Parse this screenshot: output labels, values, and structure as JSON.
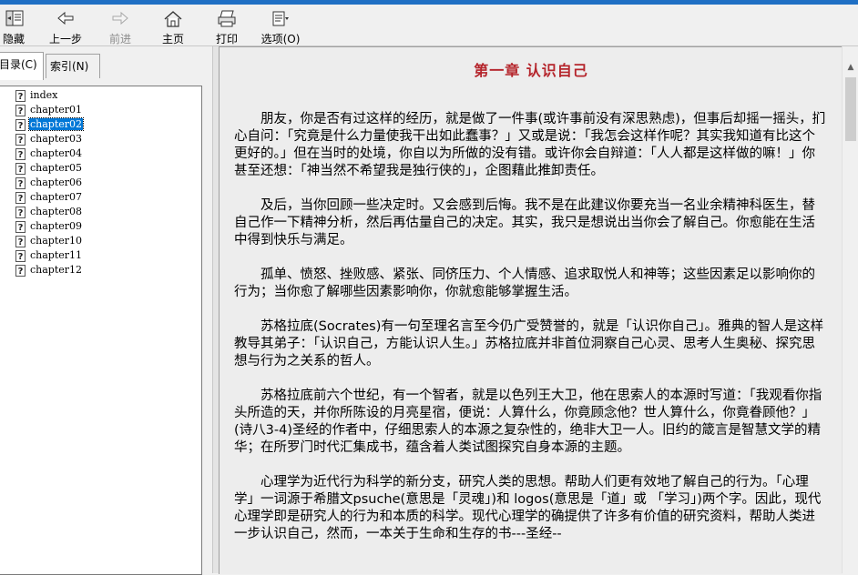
{
  "toolbar": {
    "hide": "隐藏",
    "back": "上一步",
    "forward": "前进",
    "home": "主页",
    "print": "打印",
    "options": "选项(O)"
  },
  "tabs": {
    "contents": "目录(C)",
    "index": "索引(N)"
  },
  "tree": {
    "items": [
      "index",
      "chapter01",
      "chapter02",
      "chapter03",
      "chapter04",
      "chapter05",
      "chapter06",
      "chapter07",
      "chapter08",
      "chapter09",
      "chapter10",
      "chapter11",
      "chapter12"
    ],
    "selected": "chapter02"
  },
  "content": {
    "title": "第一章  认识自己",
    "paragraphs": [
      "朋友，你是否有过这样的经历，就是做了一件事(或许事前没有深思熟虑)，但事后却摇一摇头，扪心自问：「究竟是什么力量使我干出如此蠢事？」又或是说：「我怎会这样作呢？其实我知道有比这个更好的。」但在当时的处境，你自以为所做的没有错。或许你会自辩道：「人人都是这样做的嘛！」你甚至还想：「神当然不希望我是独行侠的」，企图藉此推卸责任。",
      "及后，当你回顾一些决定时。又会感到后悔。我不是在此建议你要充当一名业余精神科医生，替自己作一下精神分析，然后再估量自己的决定。其实，我只是想说出当你会了解自己。你愈能在生活中得到快乐与满足。",
      "孤单、愤怒、挫败感、紧张、同侪压力、个人情感、追求取悦人和神等；这些因素足以影响你的行为；当你愈了解哪些因素影响你，你就愈能够掌握生活。",
      "苏格拉底(Socrates)有一句至理名言至今仍广受赞誉的，就是「认识你自己」。雅典的智人是这样教导其弟子：「认识自己，方能认识人生。」苏格拉底并非首位洞察自己心灵、思考人生奥秘、探究思想与行为之关系的哲人。",
      "苏格拉底前六个世纪，有一个智者，就是以色列王大卫，他在思索人的本源时写道：「我观看你指头所造的天，并你所陈设的月亮星宿，便说：人算什么，你竟顾念他？世人算什么，你竟眷顾他？」(诗八3-4)圣经的作者中，仔细思索人的本源之复杂性的，绝非大卫一人。旧约的箴言是智慧文学的精华；在所罗门时代汇集成书，蕴含着人类试图探究自身本源的主题。",
      "心理学为近代行为科学的新分支，研究人类的思想。帮助人们更有效地了解自己的行为。「心理学」一词源于希腊文psuche(意思是「灵魂」)和 logos(意思是「道」或 「学习」)两个字。因此，现代心理学即是研究人的行为和本质的科学。现代心理学的确提供了许多有价值的研究资料，帮助人类进一步认识自己，然而，一本关于生命和生存的书---圣经--"
    ]
  },
  "colors": {
    "title": "#b5252c",
    "selection": "#0078d7",
    "titlebar": "#1f6fc4"
  }
}
